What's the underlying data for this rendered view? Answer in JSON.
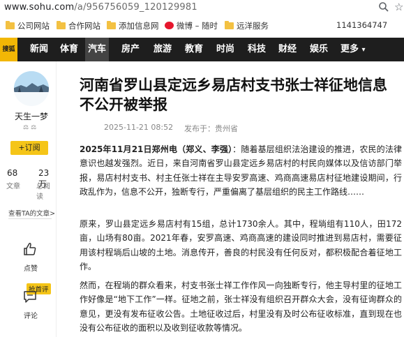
{
  "browser": {
    "url_host": "www.sohu.com",
    "url_path": "/a/956756059_120129981"
  },
  "bookmarks": {
    "items": [
      {
        "label": "公司网站"
      },
      {
        "label": "合作网站"
      },
      {
        "label": "添加信息网"
      },
      {
        "label": "微博 – 随时"
      },
      {
        "label": "远洋服务"
      }
    ],
    "number": "1141364747"
  },
  "nav": {
    "logo": "搜狐",
    "items": [
      "新闻",
      "体育",
      "汽车",
      "房产",
      "旅游",
      "教育",
      "时尚",
      "科技",
      "财经",
      "娱乐",
      "更多"
    ],
    "active": "汽车",
    "more_arrow": "▾"
  },
  "sidebar": {
    "author": "天生一梦",
    "follow": "+订阅",
    "articles_count": "68",
    "articles_label": "文章",
    "reads_count": "23万",
    "reads_label": "总阅读",
    "more_link": "查看TA的文章>",
    "like_label": "点赞",
    "comment_badge": "抢首评",
    "comment_label": "评论"
  },
  "article": {
    "title": "河南省罗山县定远乡易店村支书张士祥征地信息不公开被举报",
    "date": "2025-11-21 08:52",
    "source": "发布于：贵州省",
    "p1_lead": "2025年11月21日郑州电（郑义、李强）",
    "p1_rest": "：随着基层组织法治建设的推进，农民的法律意识也越发强烈。近日，来自河南省罗山县定远乡易店村的村民向媒体以及信访部门举报，易店村村支书、村主任张士祥在主导安罗高速、鸡商高速易店村征地建设期间，行政乱作为，信息不公开，独断专行，严重偏离了基层组织的民主工作路线……",
    "p2": "原来，罗山县定远乡易店村有15组，总计1730余人。其中，程埫组有110人，田172亩，山场有80亩。2021年春，安罗高速、鸡商高速的建设同时推进到易店村，需要征用该村程埫后山坡的土地。消息传开，善良的村民没有任何反对，都积极配合着征地工作。",
    "p3": "然而，在程埫的群众看来，村支书张士祥工作作风一向独断专行，他主导村里的征地工作好像是“地下工作”一样。征地之前，张士祥没有组织召开群众大会，没有征询群众的意见，更没有发布征收公告。土地征收过后，村里没有及时公布征收标准，直到现在也没有公布征收的面积以及收到征收款等情况。"
  }
}
